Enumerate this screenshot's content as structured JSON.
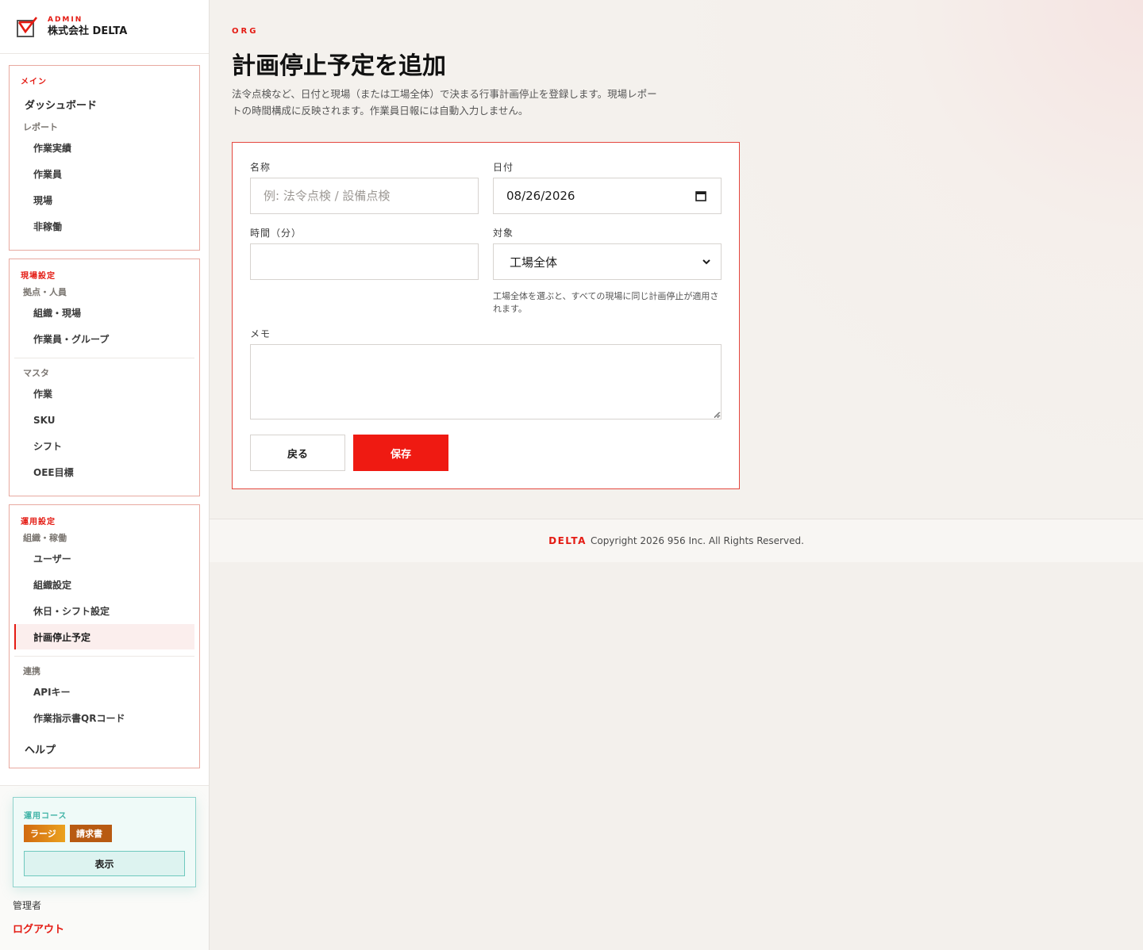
{
  "brand": {
    "kicker": "ADMIN",
    "name": "株式会社 DELTA"
  },
  "sidebar": {
    "main": {
      "title": "メイン",
      "dashboard": "ダッシュボード",
      "report_title": "レポート",
      "items": [
        "作業実績",
        "作業員",
        "現場",
        "非稼働"
      ]
    },
    "site": {
      "title": "現場設定",
      "base_title": "拠点・人員",
      "base_items": [
        "組織・現場",
        "作業員・グループ"
      ],
      "master_title": "マスタ",
      "master_items": [
        "作業",
        "SKU",
        "シフト",
        "OEE目標"
      ]
    },
    "ops": {
      "title": "運用設定",
      "org_title": "組織・稼働",
      "org_items": [
        "ユーザー",
        "組織設定",
        "休日・シフト設定",
        "計画停止予定"
      ],
      "link_title": "連携",
      "link_items": [
        "APIキー",
        "作業指示書QRコード"
      ],
      "help": "ヘルプ"
    },
    "course": {
      "title": "運用コース",
      "badge_plan": "ラージ",
      "badge_invoice": "請求書",
      "show_button": "表示"
    },
    "role": "管理者",
    "logout": "ログアウト"
  },
  "header": {
    "kicker": "ORG",
    "title": "計画停止予定を追加",
    "description": "法令点検など、日付と現場（または工場全体）で決まる行事計画停止を登録します。現場レポートの時間構成に反映されます。作業員日報には自動入力しません。"
  },
  "form": {
    "name_label": "名称",
    "name_placeholder": "例: 法令点検 / 設備点検",
    "date_label": "日付",
    "date_value": "08/26/2026",
    "minutes_label": "時間（分）",
    "minutes_value": "",
    "target_label": "対象",
    "target_value": "工場全体",
    "target_hint": "工場全体を選ぶと、すべての現場に同じ計画停止が適用されます。",
    "memo_label": "メモ",
    "back_button": "戻る",
    "save_button": "保存"
  },
  "footer": {
    "brand": "DELTA",
    "copyright": "Copyright 2026 956 Inc. All Rights Reserved."
  },
  "colors": {
    "accent": "#e41b13",
    "save": "#ef1a12",
    "teal": "#3fb3a6",
    "orange": "#d16a10"
  }
}
